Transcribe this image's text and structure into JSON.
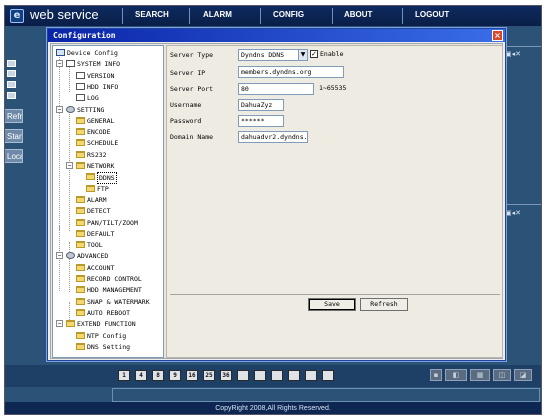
{
  "app": {
    "title": "web service",
    "nav": [
      "SEARCH",
      "ALARM",
      "CONFIG",
      "ABOUT",
      "LOGOUT"
    ],
    "side_buttons": [
      "Refre",
      "Start/a",
      "Local P"
    ],
    "footer": "CopyRight 2008,All Rights Reserved.",
    "camera_buttons": [
      "1",
      "4",
      "8",
      "9",
      "16",
      "25",
      "36"
    ]
  },
  "dialog": {
    "title": "Configuration",
    "close_glyph": "×"
  },
  "tree": [
    {
      "label": "Device Config",
      "icon": "computer-icon",
      "level": 0
    },
    {
      "label": "SYSTEM INFO",
      "icon": "info-page-icon",
      "level": 1,
      "expander": "−"
    },
    {
      "label": "VERSION",
      "icon": "page-icon",
      "level": 2
    },
    {
      "label": "HDD INFO",
      "icon": "page-icon",
      "level": 2
    },
    {
      "label": "LOG",
      "icon": "page-icon",
      "level": 2
    },
    {
      "label": "SETTING",
      "icon": "settings-icon",
      "level": 1,
      "expander": "−"
    },
    {
      "label": "GENERAL",
      "icon": "folder-icon",
      "level": 2
    },
    {
      "label": "ENCODE",
      "icon": "folder-icon",
      "level": 2
    },
    {
      "label": "SCHEDULE",
      "icon": "folder-icon",
      "level": 2
    },
    {
      "label": "RS232",
      "icon": "folder-icon",
      "level": 2
    },
    {
      "label": "NETWORK",
      "icon": "folder-icon",
      "level": 2,
      "expander": "−"
    },
    {
      "label": "DDNS",
      "icon": "folder-icon",
      "level": 3,
      "selected": true
    },
    {
      "label": "FTP",
      "icon": "folder-icon",
      "level": 3
    },
    {
      "label": "ALARM",
      "icon": "folder-icon",
      "level": 2
    },
    {
      "label": "DETECT",
      "icon": "folder-icon",
      "level": 2
    },
    {
      "label": "PAN/TILT/ZOOM",
      "icon": "folder-icon",
      "level": 2
    },
    {
      "label": "DEFAULT",
      "icon": "folder-icon",
      "level": 2
    },
    {
      "label": "TOOL",
      "icon": "folder-icon",
      "level": 2
    },
    {
      "label": "ADVANCED",
      "icon": "gear-icon",
      "level": 1,
      "expander": "−"
    },
    {
      "label": "ACCOUNT",
      "icon": "folder-icon",
      "level": 2
    },
    {
      "label": "RECORD CONTROL",
      "icon": "folder-icon",
      "level": 2
    },
    {
      "label": "HDD MANAGEMENT",
      "icon": "folder-icon",
      "level": 2
    },
    {
      "label": "SNAP & WATERMARK",
      "icon": "folder-icon",
      "level": 2
    },
    {
      "label": "AUTO REBOOT",
      "icon": "folder-icon",
      "level": 2
    },
    {
      "label": "EXTEND FUNCTION",
      "icon": "folder-icon",
      "level": 1,
      "expander": "−"
    },
    {
      "label": "NTP Config",
      "icon": "folder-icon",
      "level": 2
    },
    {
      "label": "DNS Setting",
      "icon": "folder-icon",
      "level": 2
    }
  ],
  "form": {
    "server_type_label": "Server Type",
    "server_type_value": "Dyndns DDNS",
    "enable_label": "Enable",
    "enable_checked": "✓",
    "server_ip_label": "Server IP",
    "server_ip_value": "members.dyndns.org",
    "server_port_label": "Server Port",
    "server_port_value": "80",
    "server_port_range": "1~65535",
    "username_label": "Username",
    "username_value": "DahuaZyz",
    "password_label": "Password",
    "password_value": "******",
    "domain_label": "Domain Name",
    "domain_value": "dahuadvr2.dyndns.o",
    "save_label": "Save",
    "refresh_label": "Refresh"
  }
}
